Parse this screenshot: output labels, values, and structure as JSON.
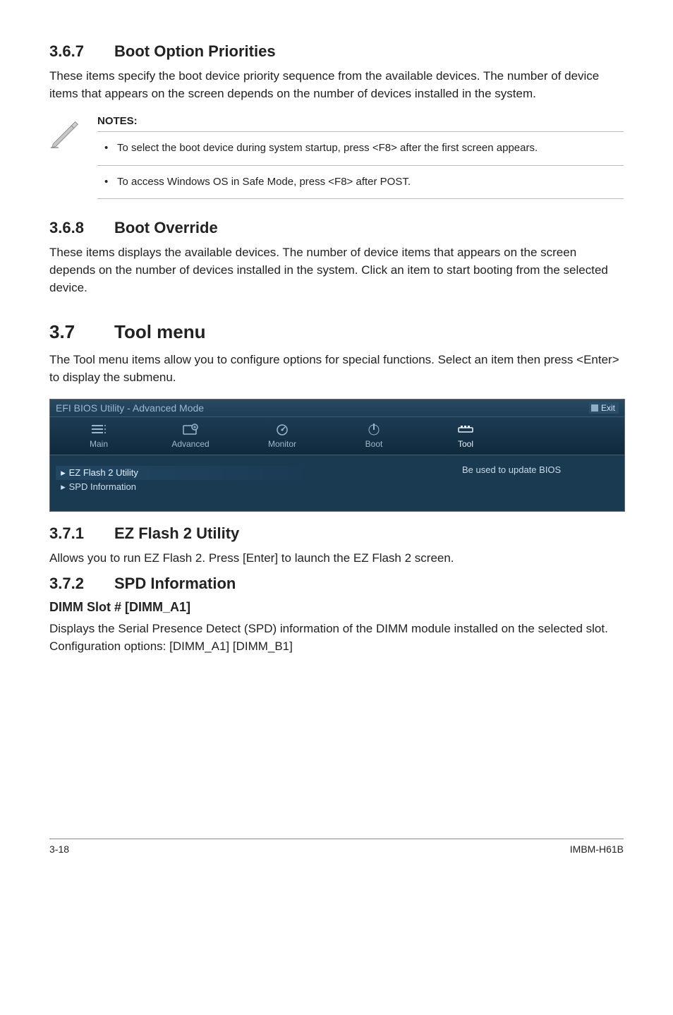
{
  "s367": {
    "num": "3.6.7",
    "title": "Boot Option Priorities",
    "body": "These items specify the boot device priority sequence from the available devices. The number of device items that appears on the screen depends on the number of devices installed in the system."
  },
  "notes": {
    "label": "NOTES:",
    "items": [
      "To select the boot device during system startup, press <F8> after the first screen appears.",
      "To access Windows OS in Safe Mode, press <F8> after POST."
    ]
  },
  "s368": {
    "num": "3.6.8",
    "title": "Boot Override",
    "body": "These items displays the available devices. The number of device items that appears on the screen depends on the number of devices installed in the system. Click an item to start booting from the selected device."
  },
  "s37": {
    "num": "3.7",
    "title": "Tool menu",
    "body": "The Tool menu items allow you to configure options for special functions. Select an item then press <Enter> to display the submenu."
  },
  "bios": {
    "header_title": "EFI BIOS Utility - Advanced Mode",
    "exit": "Exit",
    "tabs": {
      "main": "Main",
      "advanced": "Advanced",
      "monitor": "Monitor",
      "boot": "Boot",
      "tool": "Tool"
    },
    "left_items": {
      "ez": "EZ Flash 2 Utility",
      "spd": "SPD Information"
    },
    "right_help": "Be used to update BIOS"
  },
  "s371": {
    "num": "3.7.1",
    "title": "EZ Flash 2 Utility",
    "body": "Allows you to run EZ Flash 2. Press [Enter] to launch the EZ Flash 2 screen."
  },
  "s372": {
    "num": "3.7.2",
    "title": "SPD Information",
    "h3": "DIMM Slot # [DIMM_A1]",
    "body": "Displays the Serial Presence Detect (SPD) information of the DIMM module installed on the selected slot. Configuration options: [DIMM_A1] [DIMM_B1]"
  },
  "footer": {
    "left": "3-18",
    "right": "IMBM-H61B"
  }
}
